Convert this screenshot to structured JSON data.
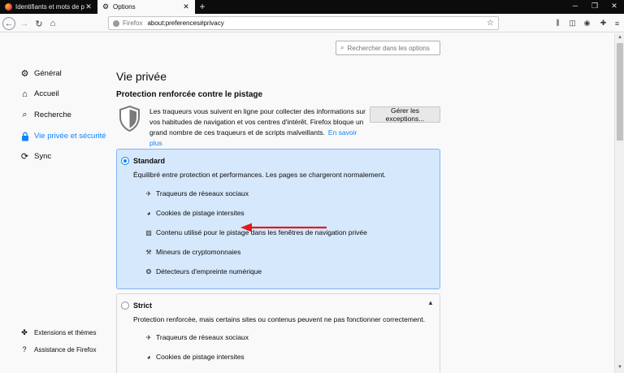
{
  "tabs": [
    {
      "label": "Identifiants et mots de passe",
      "active": false
    },
    {
      "label": "Options",
      "active": true
    }
  ],
  "toolbar": {
    "identity_label": "Firefox",
    "url": "about:preferences#privacy"
  },
  "search": {
    "placeholder": "Rechercher dans les options"
  },
  "sidebar": {
    "categories": [
      {
        "label": "Général",
        "icon": "gear-icon"
      },
      {
        "label": "Accueil",
        "icon": "home-icon"
      },
      {
        "label": "Recherche",
        "icon": "search-icon"
      },
      {
        "label": "Vie privée et sécurité",
        "icon": "lock-icon",
        "selected": true
      },
      {
        "label": "Sync",
        "icon": "sync-icon"
      }
    ],
    "footer": [
      {
        "label": "Extensions et thèmes",
        "icon": "puzzle-icon"
      },
      {
        "label": "Assistance de Firefox",
        "icon": "help-icon"
      }
    ]
  },
  "main": {
    "pane_title": "Vie privée",
    "section_title": "Protection renforcée contre le pistage",
    "description": "Les traqueurs vous suivent en ligne pour collecter des informations sur vos habitudes de navigation et vos centres d'intérêt. Firefox bloque un grand nombre de ces traqueurs et de scripts malveillants.",
    "learn_more": "En savoir plus",
    "exceptions_button": "Gérer les exceptions...",
    "options": [
      {
        "name": "Standard",
        "selected": true,
        "description": "Équilibré entre protection et performances. Les pages se chargeront normalement.",
        "features": [
          "Traqueurs de réseaux sociaux",
          "Cookies de pistage intersites",
          "Contenu utilisé pour le pistage dans les fenêtres de navigation privée",
          "Mineurs de cryptomonnaies",
          "Détecteurs d'empreinte numérique"
        ]
      },
      {
        "name": "Strict",
        "selected": false,
        "description": "Protection renforcée, mais certains sites ou contenus peuvent ne pas fonctionner correctement.",
        "features": [
          "Traqueurs de réseaux sociaux",
          "Cookies de pistage intersites"
        ]
      }
    ]
  },
  "colors": {
    "accent": "#0a84ff",
    "selected_box": "#d6e8fb",
    "annotation_arrow": "#e01b1b"
  }
}
